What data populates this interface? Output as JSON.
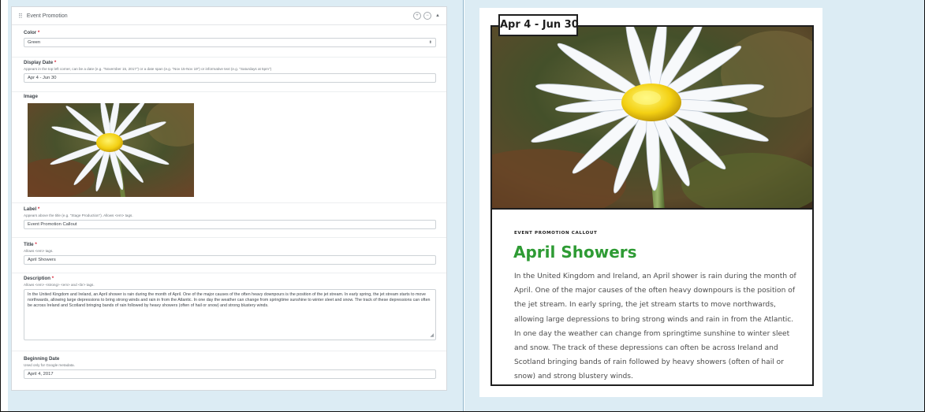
{
  "form": {
    "panel_title": "Event Promotion",
    "color": {
      "label": "Color",
      "value": "Green"
    },
    "display_date": {
      "label": "Display Date",
      "help": "Appears in the top left corner, can be a date (e.g. \"November 15, 2017\") or a date span (e.g. \"Nov 15-Nov 19\") or informative text (e.g. \"Saturdays at 5pm\")",
      "value": "Apr 4 - Jun 30"
    },
    "image": {
      "label": "Image"
    },
    "label_field": {
      "label": "Label",
      "help": "Appears above the title (e.g. \"Stage Production\"). Allows <em> tags.",
      "value": "Event Promotion Callout"
    },
    "title_field": {
      "label": "Title",
      "help": "Allows <em> tags.",
      "value": "April Showers"
    },
    "description_field": {
      "label": "Description",
      "help": "Allows <em> <strong> <em> and <br> tags.",
      "value": "In the United Kingdom and Ireland, an April shower is rain during the month of April. One of the major causes of the often heavy downpours is the position of the jet stream. In early spring, the jet stream starts to move northwards, allowing large depressions to bring strong winds and rain in from the Atlantic. In one day the weather can change from springtime sunshine to winter sleet and snow. The track of these depressions can often be across Ireland and Scotland bringing bands of rain followed by heavy showers (often of hail or snow) and strong blustery winds."
    },
    "beginning_date": {
      "label": "Beginning Date",
      "help": "Used only for Google metadata.",
      "value": "April 4, 2017"
    },
    "required_mark": "*"
  },
  "preview": {
    "date_tag": "Apr 4 - Jun 30",
    "label": "EVENT PROMOTION CALLOUT",
    "title": "April Showers",
    "description": "In the United Kingdom and Ireland, an April shower is rain during the month of April. One of the major causes of the often heavy downpours is the position of the jet stream. In early spring, the jet stream starts to move northwards, allowing large depressions to bring strong winds and rain in from the Atlantic. In one day the weather can change from springtime sunshine to winter sleet and snow. The track of these depressions can often be across Ireland and Scotland bringing bands of rain followed by heavy showers (often of hail or snow) and strong blustery winds."
  },
  "colors": {
    "title_green": "#2e9b34",
    "required_red": "#d9283b",
    "cell_bg": "#dcecf4",
    "card_border": "#1e1e1e"
  },
  "icons": [
    "grip-icon",
    "circle-plus-icon",
    "circle-minus-icon",
    "caret-up-icon",
    "select-arrow-icon",
    "resize-handle-icon"
  ]
}
